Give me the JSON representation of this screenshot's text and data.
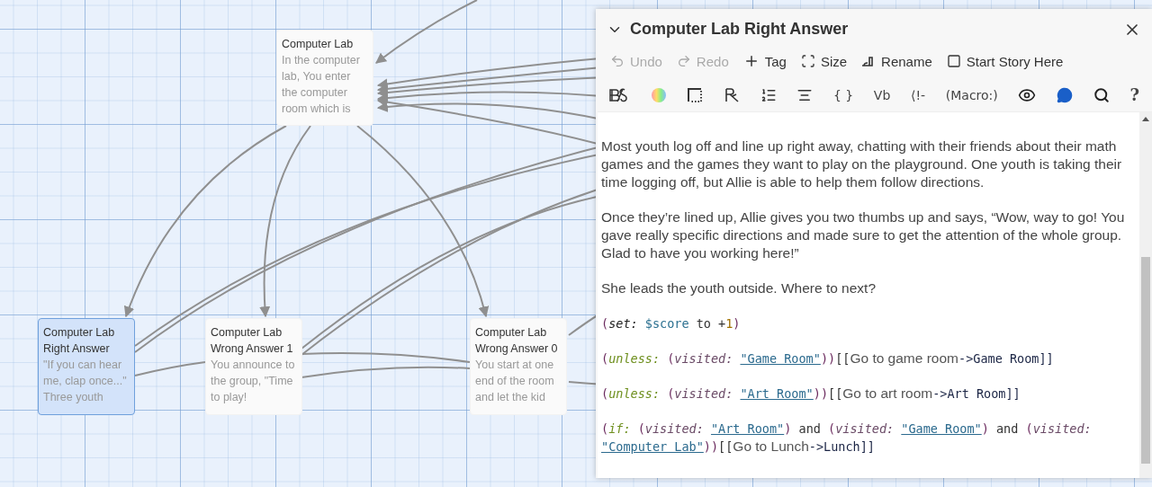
{
  "story_map": {
    "passages": [
      {
        "title": "Computer Lab",
        "excerpt": "In the computer lab, You enter the computer room which is",
        "selected": false
      },
      {
        "title": "Computer Lab Right Answer",
        "excerpt": "\"If you can hear me, clap once...\" Three youth",
        "selected": true
      },
      {
        "title": "Computer Lab Wrong Answer 1",
        "excerpt": "You announce to the group, \"Time to play!",
        "selected": false
      },
      {
        "title": "Computer Lab Wrong Answer 0",
        "excerpt": "You start at one end of the room and let the kid",
        "selected": false
      }
    ]
  },
  "editor": {
    "title": "Computer Lab Right Answer",
    "actions": [
      {
        "label": "Undo",
        "disabled": true
      },
      {
        "label": "Redo",
        "disabled": true
      },
      {
        "label": "Tag",
        "disabled": false
      },
      {
        "label": "Size",
        "disabled": false
      },
      {
        "label": "Rename",
        "disabled": false
      }
    ],
    "start_story_here": {
      "label": "Start Story Here",
      "checked": false
    },
    "format_toolbar": {
      "labels": [
        "{ }",
        "Vb",
        "⟨!-",
        "(Macro:)",
        "?"
      ]
    },
    "paragraphs": [
      "Most youth log off and line up right away, chatting with their friends about their math games and the games they want to play on the playground. One youth is taking their time logging off, but Allie is able to help them follow directions.",
      "Once they’re lined up, Allie gives you two thumbs up and says, “Wow, way to go! You gave really specific directions and made sure to get the attention of the whole group. Glad to have you working here!”",
      "She leads the youth outside. Where to next?"
    ],
    "code_lines": [
      [
        {
          "kind": "paren",
          "text": "("
        },
        {
          "kind": "macro",
          "text": "set: "
        },
        {
          "kind": "var",
          "text": "$score"
        },
        {
          "kind": "plain",
          "text": " to +"
        },
        {
          "kind": "number",
          "text": "1"
        },
        {
          "kind": "paren",
          "text": ")"
        }
      ],
      [
        {
          "kind": "paren",
          "text": "("
        },
        {
          "kind": "changer",
          "text": "unless: "
        },
        {
          "kind": "paren",
          "text": "("
        },
        {
          "kind": "call",
          "text": "visited: "
        },
        {
          "kind": "string",
          "text": "\"Game Room\""
        },
        {
          "kind": "paren",
          "text": "))"
        },
        {
          "kind": "plain",
          "text": "[["
        },
        {
          "kind": "link",
          "text": "Go to game room"
        },
        {
          "kind": "target",
          "text": "->Game Room]]"
        }
      ],
      [
        {
          "kind": "paren",
          "text": "("
        },
        {
          "kind": "changer",
          "text": "unless: "
        },
        {
          "kind": "paren",
          "text": "("
        },
        {
          "kind": "call",
          "text": "visited: "
        },
        {
          "kind": "string",
          "text": "\"Art Room\""
        },
        {
          "kind": "paren",
          "text": "))"
        },
        {
          "kind": "plain",
          "text": "[["
        },
        {
          "kind": "link",
          "text": "Go to art room"
        },
        {
          "kind": "target",
          "text": "->Art Room]]"
        }
      ],
      [
        {
          "kind": "paren",
          "text": "("
        },
        {
          "kind": "changer",
          "text": "if: "
        },
        {
          "kind": "paren",
          "text": "("
        },
        {
          "kind": "call",
          "text": "visited: "
        },
        {
          "kind": "string",
          "text": "\"Art Room\""
        },
        {
          "kind": "paren",
          "text": ")"
        },
        {
          "kind": "plain",
          "text": " and "
        },
        {
          "kind": "paren",
          "text": "("
        },
        {
          "kind": "call",
          "text": "visited: "
        },
        {
          "kind": "string",
          "text": "\"Game Room\""
        },
        {
          "kind": "paren",
          "text": ")"
        },
        {
          "kind": "plain",
          "text": " and "
        },
        {
          "kind": "paren",
          "text": "("
        },
        {
          "kind": "call",
          "text": "visited: "
        },
        {
          "kind": "string",
          "text": "\"Computer Lab\""
        },
        {
          "kind": "paren",
          "text": "))"
        },
        {
          "kind": "plain",
          "text": "[["
        },
        {
          "kind": "link",
          "text": "Go to Lunch"
        },
        {
          "kind": "target",
          "text": "->Lunch]]"
        }
      ]
    ]
  }
}
